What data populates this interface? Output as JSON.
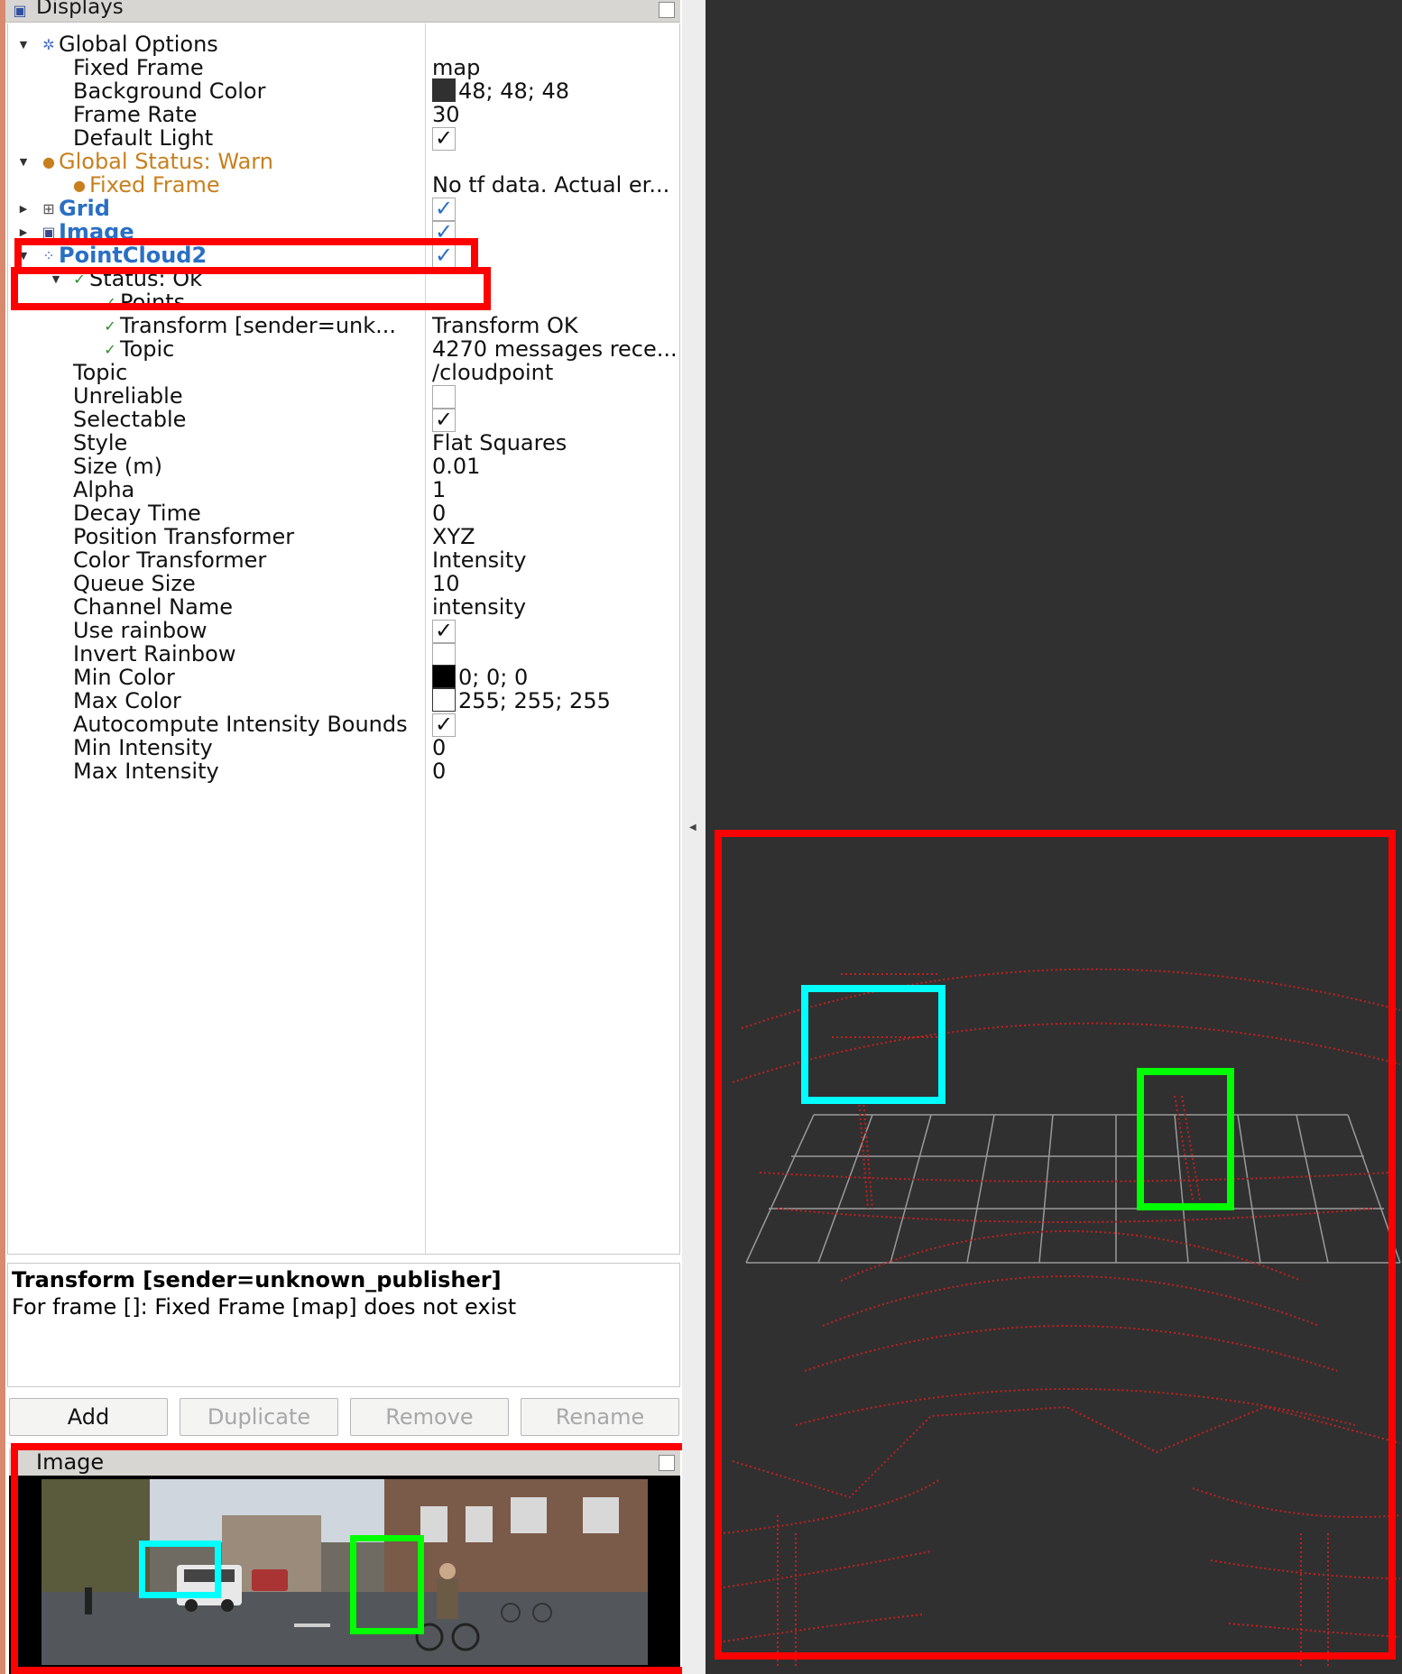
{
  "displays_panel": {
    "title": "Displays",
    "rows": [
      {
        "name": "Global Options",
        "value": ""
      },
      {
        "name": "Fixed Frame",
        "value": "map"
      },
      {
        "name": "Background Color",
        "value": "48; 48; 48"
      },
      {
        "name": "Frame Rate",
        "value": "30"
      },
      {
        "name": "Default Light",
        "value": ""
      },
      {
        "name": "Global Status: Warn",
        "value": ""
      },
      {
        "name": "Fixed Frame",
        "value": "No tf data.  Actual er..."
      },
      {
        "name": "Grid",
        "value": ""
      },
      {
        "name": "Image",
        "value": ""
      },
      {
        "name": "PointCloud2",
        "value": ""
      },
      {
        "name": "Status: Ok",
        "value": ""
      },
      {
        "name": "Points",
        "value": ""
      },
      {
        "name": "Transform [sender=unk...",
        "value": "Transform OK"
      },
      {
        "name": "Topic",
        "value": "4270 messages rece..."
      },
      {
        "name": "Topic",
        "value": "/cloudpoint"
      },
      {
        "name": "Unreliable",
        "value": ""
      },
      {
        "name": "Selectable",
        "value": ""
      },
      {
        "name": "Style",
        "value": "Flat Squares"
      },
      {
        "name": "Size (m)",
        "value": "0.01"
      },
      {
        "name": "Alpha",
        "value": "1"
      },
      {
        "name": "Decay Time",
        "value": "0"
      },
      {
        "name": "Position Transformer",
        "value": "XYZ"
      },
      {
        "name": "Color Transformer",
        "value": "Intensity"
      },
      {
        "name": "Queue Size",
        "value": "10"
      },
      {
        "name": "Channel Name",
        "value": "intensity"
      },
      {
        "name": "Use rainbow",
        "value": ""
      },
      {
        "name": "Invert Rainbow",
        "value": ""
      },
      {
        "name": "Min Color",
        "value": "0; 0; 0"
      },
      {
        "name": "Max Color",
        "value": "255; 255; 255"
      },
      {
        "name": "Autocompute Intensity Bounds",
        "value": ""
      },
      {
        "name": "Min Intensity",
        "value": "0"
      },
      {
        "name": "Max Intensity",
        "value": "0"
      }
    ],
    "checks": {
      "default_light": true,
      "grid": true,
      "image": true,
      "pointcloud2": true,
      "unreliable": false,
      "selectable": true,
      "use_rainbow": true,
      "invert_rainbow": false,
      "autocompute": true
    },
    "colors": {
      "background_swatch": "#303030",
      "min_color_swatch": "#000000",
      "max_color_swatch": "#ffffff"
    }
  },
  "description": {
    "title": "Transform [sender=unknown_publisher]",
    "text": "For frame []: Fixed Frame [map] does not exist"
  },
  "buttons": {
    "add": "Add",
    "duplicate": "Duplicate",
    "remove": "Remove",
    "rename": "Rename"
  },
  "image_panel": {
    "title": "Image"
  },
  "theme": {
    "warn": "#c8801e",
    "display_blue": "#2a6fc4",
    "ok_green": "#2a8a2a",
    "annotation_red": "#ff0000",
    "annotation_cyan": "#00ffff",
    "annotation_green": "#00ff00",
    "view_background": "#303030"
  }
}
